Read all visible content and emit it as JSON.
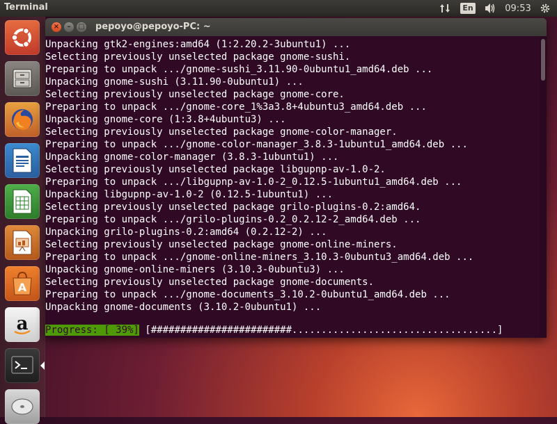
{
  "panel": {
    "app_title": "Terminal",
    "keyboard_layout": "En",
    "clock": "09:53"
  },
  "launcher": {
    "items": [
      {
        "name": "Dash",
        "icon": "ubuntu-logo-icon"
      },
      {
        "name": "Files",
        "icon": "file-cabinet-icon"
      },
      {
        "name": "Firefox",
        "icon": "firefox-icon"
      },
      {
        "name": "LibreOffice Writer",
        "icon": "writer-icon"
      },
      {
        "name": "LibreOffice Calc",
        "icon": "calc-icon"
      },
      {
        "name": "LibreOffice Impress",
        "icon": "impress-icon"
      },
      {
        "name": "Ubuntu Software",
        "icon": "software-bag-icon"
      },
      {
        "name": "Amazon",
        "icon": "amazon-icon"
      },
      {
        "name": "Terminal",
        "icon": "terminal-icon"
      },
      {
        "name": "DVD",
        "icon": "dvd-icon"
      }
    ]
  },
  "window": {
    "title": "pepoyo@pepoyo-PC: ~"
  },
  "terminal": {
    "lines": [
      "Unpacking gtk2-engines:amd64 (1:2.20.2-3ubuntu1) ...",
      "Selecting previously unselected package gnome-sushi.",
      "Preparing to unpack .../gnome-sushi_3.11.90-0ubuntu1_amd64.deb ...",
      "Unpacking gnome-sushi (3.11.90-0ubuntu1) ...",
      "Selecting previously unselected package gnome-core.",
      "Preparing to unpack .../gnome-core_1%3a3.8+4ubuntu3_amd64.deb ...",
      "Unpacking gnome-core (1:3.8+4ubuntu3) ...",
      "Selecting previously unselected package gnome-color-manager.",
      "Preparing to unpack .../gnome-color-manager_3.8.3-1ubuntu1_amd64.deb ...",
      "Unpacking gnome-color-manager (3.8.3-1ubuntu1) ...",
      "Selecting previously unselected package libgupnp-av-1.0-2.",
      "Preparing to unpack .../libgupnp-av-1.0-2_0.12.5-1ubuntu1_amd64.deb ...",
      "Unpacking libgupnp-av-1.0-2 (0.12.5-1ubuntu1) ...",
      "Selecting previously unselected package grilo-plugins-0.2:amd64.",
      "Preparing to unpack .../grilo-plugins-0.2_0.2.12-2_amd64.deb ...",
      "Unpacking grilo-plugins-0.2:amd64 (0.2.12-2) ...",
      "Selecting previously unselected package gnome-online-miners.",
      "Preparing to unpack .../gnome-online-miners_3.10.3-0ubuntu3_amd64.deb ...",
      "Unpacking gnome-online-miners (3.10.3-0ubuntu3) ...",
      "Selecting previously unselected package gnome-documents.",
      "Preparing to unpack .../gnome-documents_3.10.2-0ubuntu1_amd64.deb ...",
      "Unpacking gnome-documents (3.10.2-0ubuntu1) ..."
    ],
    "progress_label": "Progress: [ 39%]",
    "progress_bar": "[########################...................................]",
    "progress_percent": 39
  },
  "colors": {
    "terminal_bg": "#300a24",
    "progress_green": "#4e9a06",
    "ubuntu_orange": "#e95420"
  }
}
